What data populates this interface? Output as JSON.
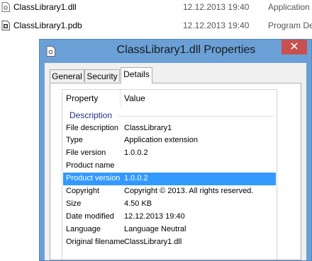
{
  "explorer": {
    "files": [
      {
        "name": "ClassLibrary1.dll",
        "date": "12.12.2013 19:40",
        "type": "Application",
        "icon": "dll-file-icon"
      },
      {
        "name": "ClassLibrary1.pdb",
        "date": "12.12.2013 19:40",
        "type": "Program De",
        "icon": "pdb-file-icon"
      }
    ]
  },
  "dialog": {
    "title": "ClassLibrary1.dll Properties",
    "close_glyph": "✕",
    "tabs": [
      {
        "label": "General"
      },
      {
        "label": "Security"
      },
      {
        "label": "Details",
        "active": true
      }
    ],
    "columns": {
      "property": "Property",
      "value": "Value"
    },
    "group": "Description",
    "rows": [
      {
        "name": "File description",
        "value": "ClassLibrary1"
      },
      {
        "name": "Type",
        "value": "Application extension"
      },
      {
        "name": "File version",
        "value": "1.0.0.2"
      },
      {
        "name": "Product name",
        "value": ""
      },
      {
        "name": "Product version",
        "value": "1.0.0.2",
        "selected": true
      },
      {
        "name": "Copyright",
        "value": "Copyright © 2013. All rights reserved."
      },
      {
        "name": "Size",
        "value": "4.50 KB"
      },
      {
        "name": "Date modified",
        "value": "12.12.2013 19:40"
      },
      {
        "name": "Language",
        "value": "Language Neutral"
      },
      {
        "name": "Original filename",
        "value": "ClassLibrary1.dll"
      }
    ]
  },
  "colors": {
    "title_bar": "#6aa0d6",
    "close_button": "#c75050",
    "selection": "#3399ff",
    "group_text": "#1e3287"
  }
}
